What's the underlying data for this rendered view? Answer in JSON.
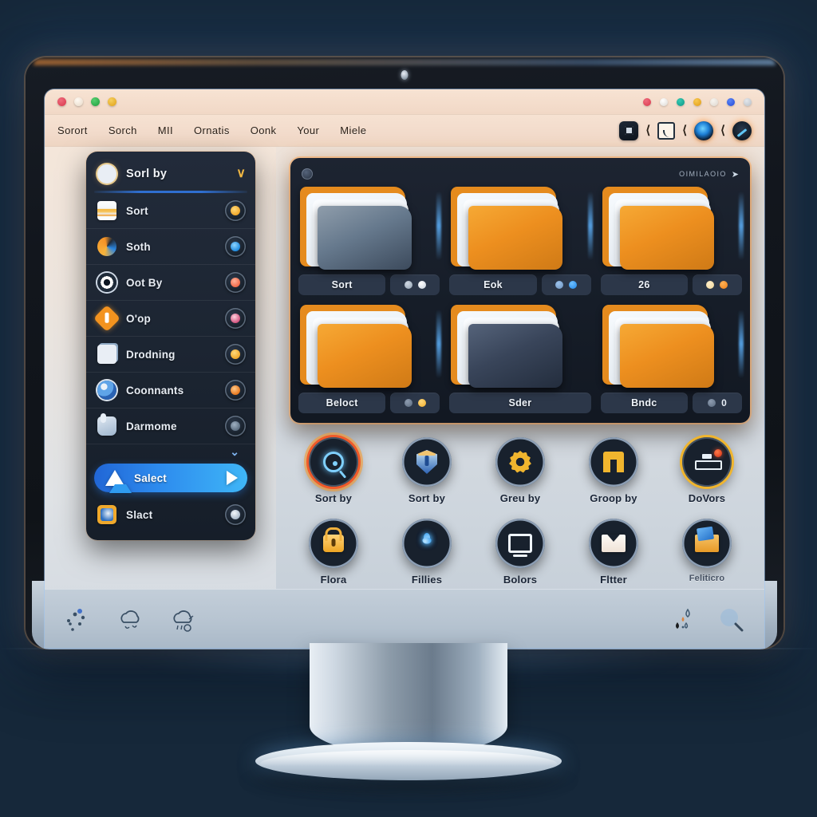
{
  "window": {
    "titlebar": {
      "left_dots": [
        {
          "name": "close-dot",
          "color": "#e0455a"
        },
        {
          "name": "minimize-dot",
          "color": "#f6e9db"
        },
        {
          "name": "maximize-dot",
          "color": "#2bb24c"
        },
        {
          "name": "extra-dot",
          "color": "#e8b52c"
        }
      ],
      "right_dots": [
        {
          "name": "status-dot-red",
          "color": "#e0455a"
        },
        {
          "name": "status-dot-white",
          "color": "#fbfbfb"
        },
        {
          "name": "status-dot-teal",
          "color": "#11a893"
        },
        {
          "name": "status-dot-amber",
          "color": "#efb027"
        },
        {
          "name": "status-dot-pale",
          "color": "#e9e5df"
        },
        {
          "name": "status-dot-blue",
          "color": "#2f63e8"
        },
        {
          "name": "status-dot-grey",
          "color": "#cfd4d9"
        }
      ]
    },
    "menubar": {
      "items": [
        {
          "label": "Sorort"
        },
        {
          "label": "Sorch"
        },
        {
          "label": "MII"
        },
        {
          "label": "Ornatis"
        },
        {
          "label": "Oonk"
        },
        {
          "label": "Your"
        },
        {
          "label": "Miele"
        }
      ],
      "tools": [
        {
          "name": "panel-toggle-icon",
          "type": "square"
        },
        {
          "name": "chevron-left-icon-1",
          "type": "chevron"
        },
        {
          "name": "note-icon",
          "type": "doc"
        },
        {
          "name": "chevron-left-icon-2",
          "type": "chevron"
        },
        {
          "name": "blue-orb-icon",
          "type": "orb"
        },
        {
          "name": "chevron-left-icon-3",
          "type": "chevron"
        },
        {
          "name": "slash-orb-icon",
          "type": "orb2"
        }
      ]
    }
  },
  "sidebar": {
    "header": {
      "label": "Sorl by",
      "icon": "target-icon",
      "caret": "∨"
    },
    "items": [
      {
        "label": "Sort",
        "icon": "list-lines-icon",
        "knob": "k-amber"
      },
      {
        "label": "Soth",
        "icon": "spiral-icon",
        "knob": "k-blue"
      },
      {
        "label": "Oot By",
        "icon": "eye-icon",
        "knob": "k-coral"
      },
      {
        "label": "O'op",
        "icon": "diamond-icon",
        "knob": "k-rose"
      },
      {
        "label": "Drodning",
        "icon": "documents-icon",
        "knob": "k-amber"
      },
      {
        "label": "Coonnants",
        "icon": "globe-icon",
        "knob": "k-orange"
      },
      {
        "label": "Darmome",
        "icon": "hand-icon",
        "knob": "k-grey"
      }
    ],
    "expand_caret": "⌄",
    "selected": {
      "label": "Salect",
      "icon": "triangle-icon",
      "trailing": "play-icon"
    },
    "last_item": {
      "label": "Slact",
      "icon": "app-image-icon",
      "knob": "k-white"
    }
  },
  "folder_panel": {
    "header": {
      "badge": "panel-badge-icon",
      "title": "OIMILAOIO",
      "arrow": "➤"
    },
    "folders": [
      {
        "name": "Sort",
        "front": "grey",
        "dots": [
          "d-grey",
          "d-white"
        ]
      },
      {
        "name": "Eok",
        "front": "orange",
        "dots": [
          "d-blued",
          "d-blue"
        ]
      },
      {
        "name": "26",
        "front": "orange",
        "dots": [
          "d-cream",
          "d-orange"
        ]
      },
      {
        "name": "Beloct",
        "front": "orange",
        "dots": [
          "d-slate",
          "d-amber"
        ]
      },
      {
        "name": "Sder",
        "front": "dark",
        "dots": []
      },
      {
        "name": "Bndc",
        "front": "orange",
        "dots": [
          "d-slate"
        ],
        "suffix": "0"
      }
    ]
  },
  "button_rows": [
    [
      {
        "label": "Sort by",
        "icon": "magnifier-target-icon",
        "ring": "ring-hot"
      },
      {
        "label": "Sort by",
        "icon": "shield-icon",
        "ring": "ring-silver"
      },
      {
        "label": "Greu by",
        "icon": "gear-icon",
        "ring": "ring-silver"
      },
      {
        "label": "Groop by",
        "icon": "bar-chart-icon",
        "ring": "ring-silver"
      },
      {
        "label": "DoVors",
        "icon": "tray-alert-icon",
        "ring": "ring-gold"
      }
    ],
    [
      {
        "label": "Flora",
        "icon": "lock-icon",
        "ring": "ring-silver"
      },
      {
        "label": "Fillies",
        "icon": "flower-icon",
        "ring": "ring-silver"
      },
      {
        "label": "Bolors",
        "icon": "monitor-icon",
        "ring": "ring-silver"
      },
      {
        "label": "Fltter",
        "icon": "mail-icon",
        "ring": "ring-silver"
      },
      {
        "label": "Feliticro",
        "icon": "mail-open-icon",
        "ring": "ring-silver"
      }
    ]
  ],
  "statusbar": {
    "left_icons": [
      {
        "name": "network-graph-icon"
      },
      {
        "name": "cloud-icon"
      },
      {
        "name": "cloud-rain-icon"
      }
    ],
    "right_icons": [
      {
        "name": "water-drops-icon"
      },
      {
        "name": "search-icon"
      }
    ]
  },
  "theme": {
    "accent_blue": "#2f8bee",
    "accent_orange": "#f0a12a",
    "panel_dark": "#1c2532",
    "screen_light": "#dcdee1"
  }
}
